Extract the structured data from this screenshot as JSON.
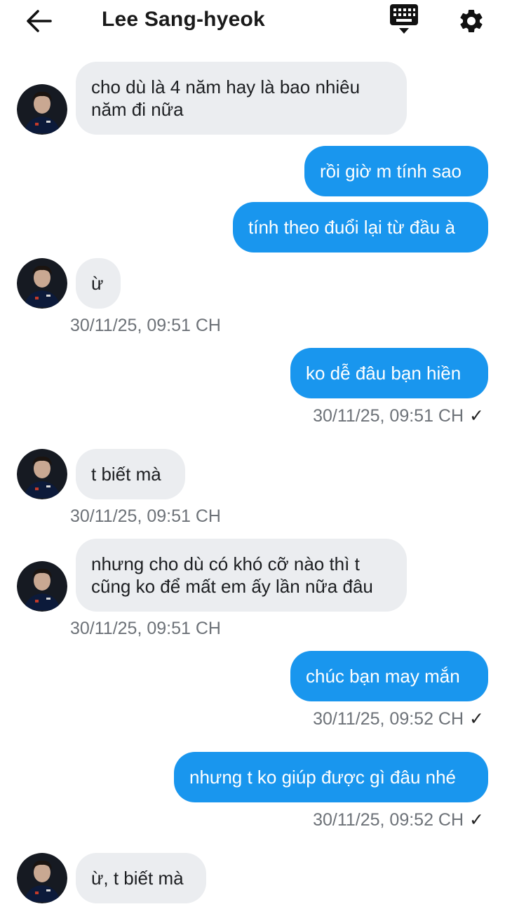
{
  "header": {
    "title": "Lee Sang-hyeok",
    "back_icon": "arrow-left-icon",
    "keyboard_icon": "keyboard-icon",
    "settings_icon": "gear-icon"
  },
  "messages": [
    {
      "from": "them",
      "lines": [
        "cho dù là 4 năm hay là bao nhiêu",
        "năm đi nữa"
      ]
    },
    {
      "from": "me",
      "lines": [
        "rồi giờ m tính sao"
      ]
    },
    {
      "from": "me",
      "lines": [
        "tính theo đuổi lại từ đầu à"
      ]
    },
    {
      "from": "them",
      "lines": [
        "ừ"
      ],
      "timestamp": "30/11/25, 09:51 CH"
    },
    {
      "from": "me",
      "lines": [
        "ko dễ đâu bạn hiền"
      ],
      "timestamp": "30/11/25, 09:51 CH",
      "status": "✓"
    },
    {
      "from": "them",
      "lines": [
        "t biết mà"
      ],
      "timestamp": "30/11/25, 09:51 CH"
    },
    {
      "from": "them",
      "lines": [
        "nhưng cho dù có khó cỡ nào thì t",
        "cũng ko để mất em ấy lần nữa đâu"
      ],
      "timestamp": "30/11/25, 09:51 CH"
    },
    {
      "from": "me",
      "lines": [
        "chúc bạn may mắn"
      ],
      "timestamp": "30/11/25, 09:52 CH",
      "status": "✓"
    },
    {
      "from": "me",
      "lines": [
        "nhưng t ko giúp được gì đâu nhé"
      ],
      "timestamp": "30/11/25, 09:52 CH",
      "status": "✓"
    },
    {
      "from": "them",
      "lines": [
        "ừ, t biết mà"
      ]
    }
  ],
  "colors": {
    "outgoing_bubble": "#1996ee",
    "incoming_bubble": "#ebedf0",
    "timestamp": "#6d7278"
  }
}
